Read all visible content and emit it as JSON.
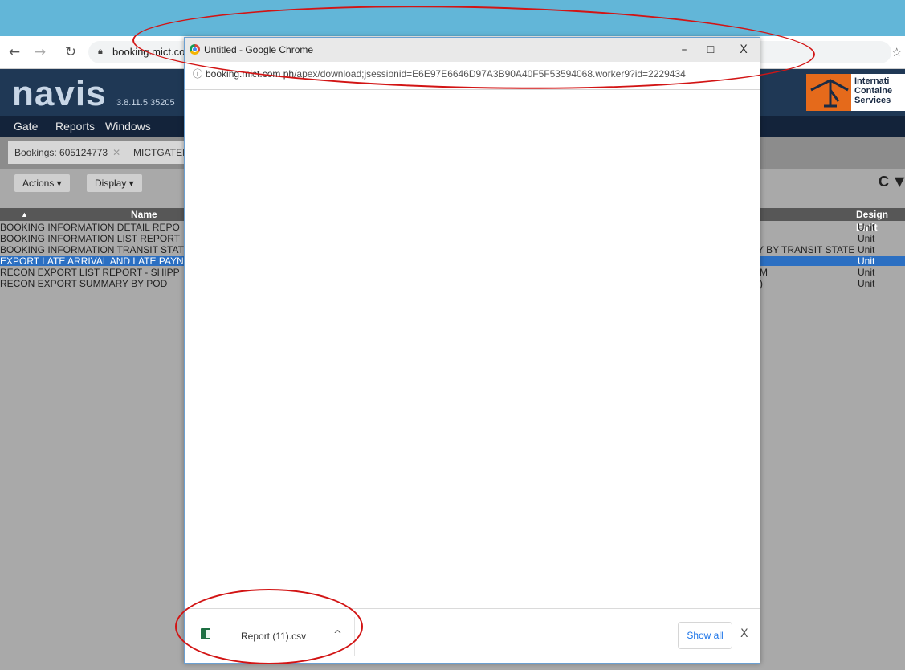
{
  "outer_browser": {
    "url": "booking.mict.co",
    "nav_icons": [
      "back-arrow-icon",
      "forward-arrow-icon",
      "reload-icon",
      "lock-icon",
      "star-icon"
    ]
  },
  "navis": {
    "logo": "navis",
    "version": "3.8.11.5.35205",
    "company_lines": [
      "Internati",
      "Containe",
      "Services"
    ],
    "menu": [
      "Gate",
      "Reports",
      "Windows"
    ],
    "tabs": [
      {
        "label": "Bookings: 605124773"
      },
      {
        "label": "MICTGATEF"
      }
    ],
    "toolbar": {
      "actions": "Actions ▾",
      "display": "Display ▾"
    },
    "grid": {
      "headers": {
        "sort": "▲",
        "name": "Name",
        "design_entity": "Design Entit"
      },
      "rows": [
        {
          "name": "BOOKING INFORMATION DETAIL REPO",
          "middle": "",
          "entity": "Unit",
          "selected": false
        },
        {
          "name": "BOOKING INFORMATION LIST REPORT",
          "middle": "",
          "entity": "Unit",
          "selected": false
        },
        {
          "name": "BOOKING INFORMATION TRANSIT STAT",
          "middle": "Y BY TRANSIT STATE",
          "entity": "Unit",
          "selected": false
        },
        {
          "name": "EXPORT LATE ARRIVAL AND LATE PAYN",
          "middle": "",
          "entity": "Unit",
          "selected": true
        },
        {
          "name": "RECON EXPORT LIST REPORT - SHIPP",
          "middle": "M",
          "entity": "Unit",
          "selected": false
        },
        {
          "name": "RECON EXPORT SUMMARY BY POD",
          "middle": ")",
          "entity": "Unit",
          "selected": false
        }
      ]
    }
  },
  "popup": {
    "title": "Untitled - Google Chrome",
    "controls": {
      "minimize": "–",
      "maximize": "☐",
      "close": "X"
    },
    "url_domain": "booking.mict.com.ph",
    "url_path": "/apex/download;jsessionid=E6E97E6646D97A3B90A40F5F53594068.worker9?id=2229434",
    "download": {
      "file_name": "Report (11).csv",
      "caret": "^",
      "show_all": "Show all",
      "close": "X"
    }
  },
  "colors": {
    "background": "#62b6d8",
    "navis_header": "#1f3855",
    "selected_row": "#2b6fc2",
    "annotation": "#d21414"
  }
}
